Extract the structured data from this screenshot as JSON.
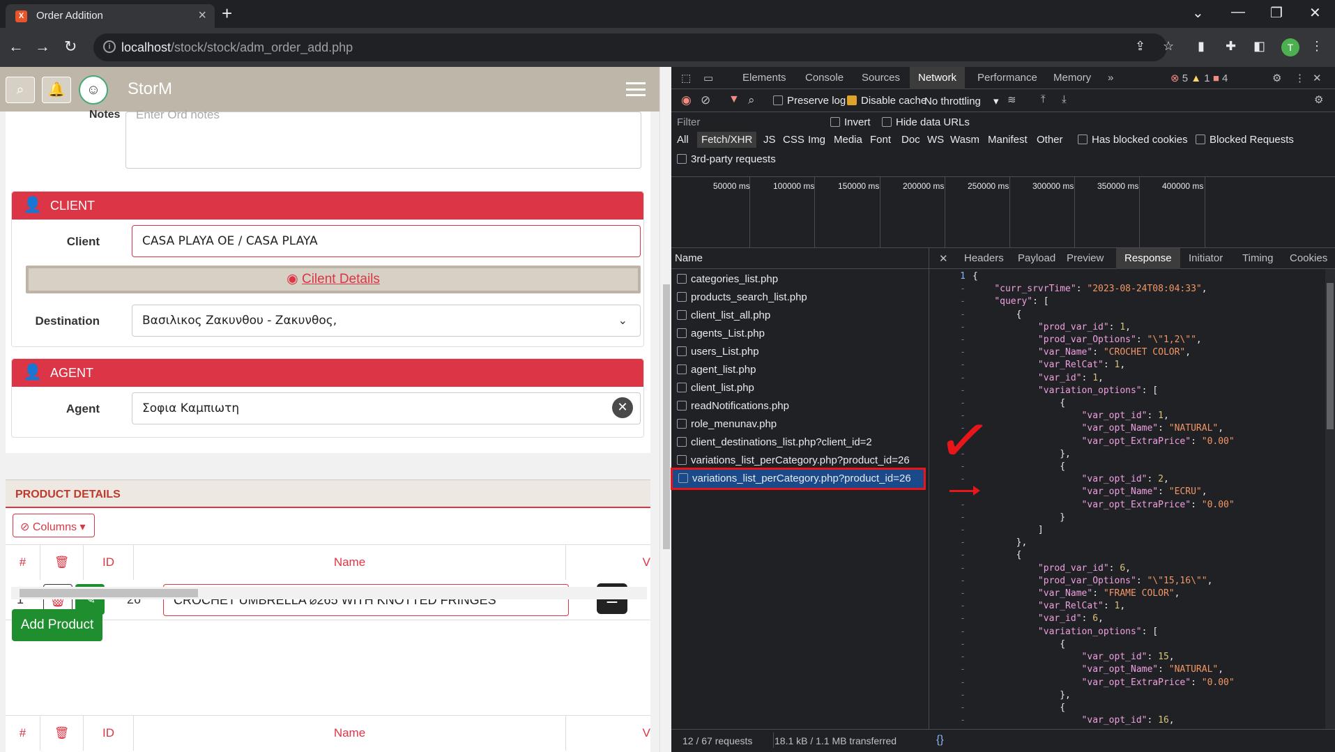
{
  "browser": {
    "tab_title": "Order Addition",
    "url_host": "localhost",
    "url_path": "/stock/stock/adm_order_add.php",
    "avatar": "T"
  },
  "app": {
    "title": "StorM",
    "notes_label": "Notes",
    "notes_placeholder": "Enter Ord notes",
    "client": {
      "header": "CLIENT",
      "label": "Client",
      "value": "CASA PLAYA OE / CASA PLAYA",
      "details": "Cilent Details",
      "dest_label": "Destination",
      "dest_value": "Βασιλικος Ζακυνθου - Ζακυνθος,"
    },
    "agent": {
      "header": "AGENT",
      "label": "Agent",
      "value": "Σοφια Καμπιωτη"
    },
    "product": {
      "header": "PRODUCT DETAILS",
      "columns_btn": "Columns",
      "cols": [
        "#",
        "ID",
        "Name",
        "V"
      ],
      "row": {
        "num": "1",
        "id": "26",
        "name": "CROCHET UMBRELLA ⌀265 WITH KNOTTED FRINGES"
      },
      "add_btn": "Add Product"
    }
  },
  "devtools": {
    "tabs": [
      "Elements",
      "Console",
      "Sources",
      "Network",
      "Performance",
      "Memory"
    ],
    "errors": "5",
    "warnings": "1",
    "issues": "4",
    "preserve_log": "Preserve log",
    "disable_cache": "Disable cache",
    "throttling": "No throttling",
    "filter_placeholder": "Filter",
    "invert": "Invert",
    "hide_data_urls": "Hide data URLs",
    "types": [
      "All",
      "Fetch/XHR",
      "JS",
      "CSS",
      "Img",
      "Media",
      "Font",
      "Doc",
      "WS",
      "Wasm",
      "Manifest",
      "Other"
    ],
    "has_blocked": "Has blocked cookies",
    "blocked_req": "Blocked Requests",
    "third_party": "3rd-party requests",
    "timeline": [
      "50000 ms",
      "100000 ms",
      "150000 ms",
      "200000 ms",
      "250000 ms",
      "300000 ms",
      "350000 ms",
      "400000 ms"
    ],
    "name_header": "Name",
    "requests": [
      "categories_list.php",
      "products_search_list.php",
      "client_list_all.php",
      "agents_List.php",
      "users_List.php",
      "agent_list.php",
      "client_list.php",
      "readNotifications.php",
      "role_menunav.php",
      "client_destinations_list.php?client_id=2",
      "variations_list_perCategory.php?product_id=26",
      "variations_list_perCategory.php?product_id=26"
    ],
    "resp_tabs": [
      "Headers",
      "Payload",
      "Preview",
      "Response",
      "Initiator",
      "Timing",
      "Cookies"
    ],
    "status": {
      "requests": "12 / 67 requests",
      "transferred": "18.1 kB / 1.1 MB transferred"
    },
    "line_no": "1"
  }
}
